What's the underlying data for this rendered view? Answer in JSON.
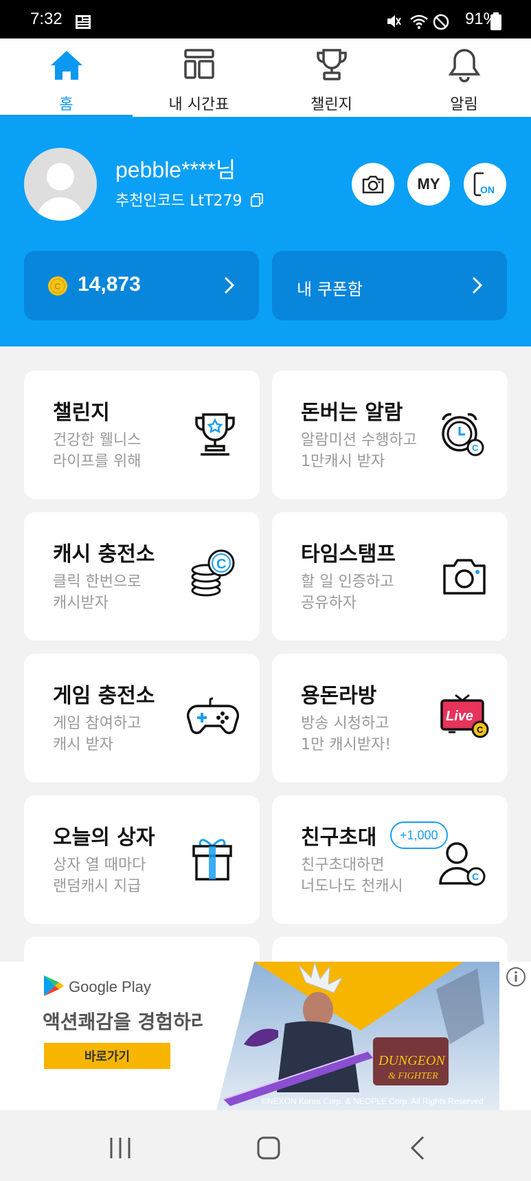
{
  "status_bar": {
    "time": "7:32",
    "battery": "91%"
  },
  "tabs": [
    {
      "label": "홈",
      "icon": "home-icon",
      "active": true
    },
    {
      "label": "내 시간표",
      "icon": "timetable-icon",
      "active": false
    },
    {
      "label": "챌린지",
      "icon": "trophy-icon",
      "active": false
    },
    {
      "label": "알림",
      "icon": "bell-icon",
      "active": false
    }
  ],
  "profile": {
    "username": "pebble****님",
    "referral": "추천인코드 LtT279",
    "my_label": "MY",
    "on_label": "ON",
    "coins": "14,873",
    "coupon_label": "내 쿠폰함"
  },
  "cards": [
    {
      "title": "챌린지",
      "desc1": "건강한 웰니스",
      "desc2": "라이프를 위해",
      "icon": "trophy-icon"
    },
    {
      "title": "돈버는 알람",
      "desc1": "알람미션 수행하고",
      "desc2": "1만캐시 받자",
      "icon": "alarm-clock-icon"
    },
    {
      "title": "캐시 충전소",
      "desc1": "클릭 한번으로",
      "desc2": "캐시받자",
      "icon": "coin-stack-icon"
    },
    {
      "title": "타임스탬프",
      "desc1": "할 일 인증하고",
      "desc2": "공유하자",
      "icon": "camera-icon"
    },
    {
      "title": "게임 충전소",
      "desc1": "게임 참여하고",
      "desc2": "캐시 받자",
      "icon": "gamepad-icon"
    },
    {
      "title": "용돈라방",
      "desc1": "방송 시청하고",
      "desc2": "1만 캐시받자!",
      "icon": "live-tv-icon",
      "icon_text": "Live"
    },
    {
      "title": "오늘의 상자",
      "desc1": "상자 열 때마다",
      "desc2": "랜덤캐시 지급",
      "icon": "gift-box-icon"
    },
    {
      "title": "친구초대",
      "desc1": "친구초대하면",
      "desc2": "너도나도 천캐시",
      "icon": "invite-friend-icon",
      "badge": "+1,000"
    }
  ],
  "coin_symbol": "C",
  "ad": {
    "brand": "Google Play",
    "headline": "액션쾌감을 경험하라!",
    "button": "바로가기",
    "copyright": "©NEXON Korea Corp. & NEOPLE Corp. All Rights Reserved"
  },
  "colors": {
    "accent": "#0aa0f5",
    "accent_dark": "#0886db",
    "coin": "#f5c518",
    "live_red": "#e8335a"
  }
}
